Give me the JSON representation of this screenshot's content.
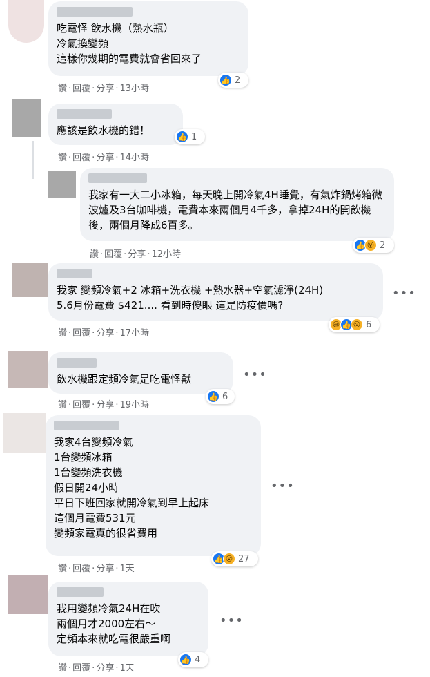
{
  "comments": [
    {
      "text": "吃電怪 飲水機（熱水瓶）\n冷氣換變頻\n這樣你幾期的電費就會省回來了",
      "actions": {
        "like": "讚",
        "reply": "回覆",
        "share": "分享",
        "time": "13小時"
      },
      "reactions": {
        "icons": [
          "like-icon"
        ],
        "count": "2"
      }
    },
    {
      "text": "應該是飲水機的錯！",
      "actions": {
        "like": "讚",
        "reply": "回覆",
        "share": "分享",
        "time": "14小時"
      },
      "reactions": {
        "icons": [
          "like-icon"
        ],
        "count": "1"
      }
    },
    {
      "text": "我家有一大二小冰箱，每天晚上開冷氣4H睡覺，有氣炸鍋烤箱微波爐及3台咖啡機，電費本來兩個月4千多，拿掉24H的開飲機後，兩個月降成6百多。",
      "actions": {
        "like": "讚",
        "reply": "回覆",
        "share": "分享",
        "time": "12小時"
      },
      "reactions": {
        "icons": [
          "like-icon",
          "wow-icon"
        ],
        "count": "2"
      }
    },
    {
      "text": "我家 變頻冷氣+2 冰箱+洗衣機 +熱水器+空氣濾淨(24H)\n5.6月份電費 $421.... 看到時傻眼 這是防疫價嗎?",
      "actions": {
        "like": "讚",
        "reply": "回覆",
        "share": "分享",
        "time": "17小時"
      },
      "reactions": {
        "icons": [
          "haha-icon",
          "like-icon",
          "wow-icon"
        ],
        "count": "6"
      }
    },
    {
      "text": "飲水機跟定頻冷氣是吃電怪獸",
      "actions": {
        "like": "讚",
        "reply": "回覆",
        "share": "分享",
        "time": "19小時"
      },
      "reactions": {
        "icons": [
          "like-icon"
        ],
        "count": "6"
      }
    },
    {
      "text": "我家4台變頻冷氣\n1台變頻冰箱\n1台變頻洗衣機\n假日開24小時\n平日下班回家就開冷氣到早上起床\n這個月電費531元\n變頻家電真的很省費用",
      "actions": {
        "like": "讚",
        "reply": "回覆",
        "share": "分享",
        "time": "1天"
      },
      "reactions": {
        "icons": [
          "like-icon",
          "wow-icon"
        ],
        "count": "27"
      }
    },
    {
      "text": "我用變頻冷氣24H在吹\n兩個月才2000左右～\n定頻本來就吃電很嚴重啊",
      "actions": {
        "like": "讚",
        "reply": "回覆",
        "share": "分享",
        "time": "1天"
      },
      "reactions": {
        "icons": [
          "like-icon"
        ],
        "count": "4"
      }
    }
  ],
  "more_label": "•••",
  "colors": {
    "bubble": "#f0f2f5",
    "link": "#65676b",
    "like": "#1877f2",
    "wow": "#f7b125"
  }
}
